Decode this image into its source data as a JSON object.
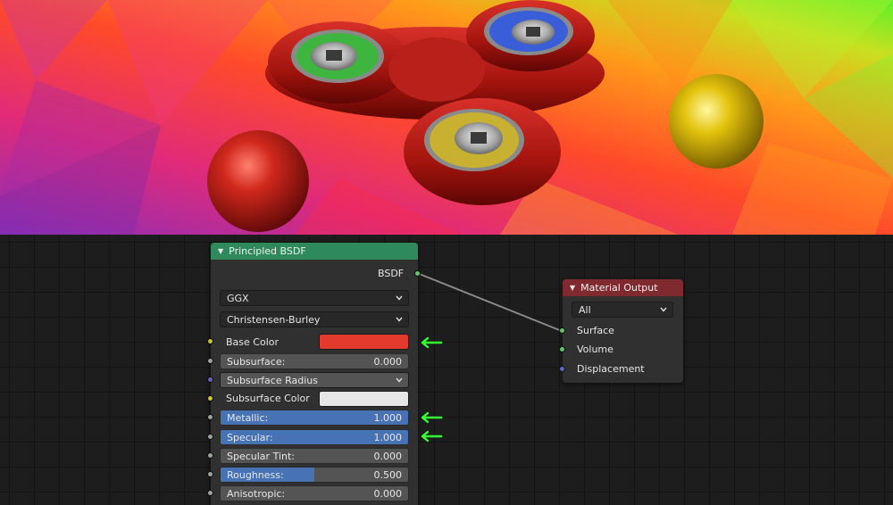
{
  "principled_node": {
    "title": "Principled BSDF",
    "output_label": "BSDF",
    "distribution": "GGX",
    "subsurface_method": "Christensen-Burley",
    "inputs": {
      "base_color_label": "Base Color",
      "base_color": "#e23b2e",
      "subsurface_label": "Subsurface:",
      "subsurface_value": "0.000",
      "subsurface_radius_label": "Subsurface Radius",
      "subsurface_color_label": "Subsurface Color",
      "subsurface_color": "#e6e6e6",
      "metallic_label": "Metallic:",
      "metallic_value": "1.000",
      "metallic_fraction": 1.0,
      "specular_label": "Specular:",
      "specular_value": "1.000",
      "specular_fraction": 1.0,
      "specular_tint_label": "Specular Tint:",
      "specular_tint_value": "0.000",
      "roughness_label": "Roughness:",
      "roughness_value": "0.500",
      "roughness_fraction": 0.5,
      "anisotropic_label": "Anisotropic:",
      "anisotropic_value": "0.000"
    }
  },
  "output_node": {
    "title": "Material Output",
    "target": "All",
    "sockets": {
      "surface": "Surface",
      "volume": "Volume",
      "displacement": "Displacement"
    }
  },
  "colors": {
    "principled_header": "#2e8a5c",
    "output_header": "#7e2a2e",
    "slider_fill": "#4772b3",
    "annotation_arrow": "#33ff33",
    "link": "#8a8a8a"
  },
  "icons": {
    "collapse": "triangle-down-icon",
    "dropdown": "chevron-down-icon",
    "annotation": "arrow-left-icon"
  }
}
